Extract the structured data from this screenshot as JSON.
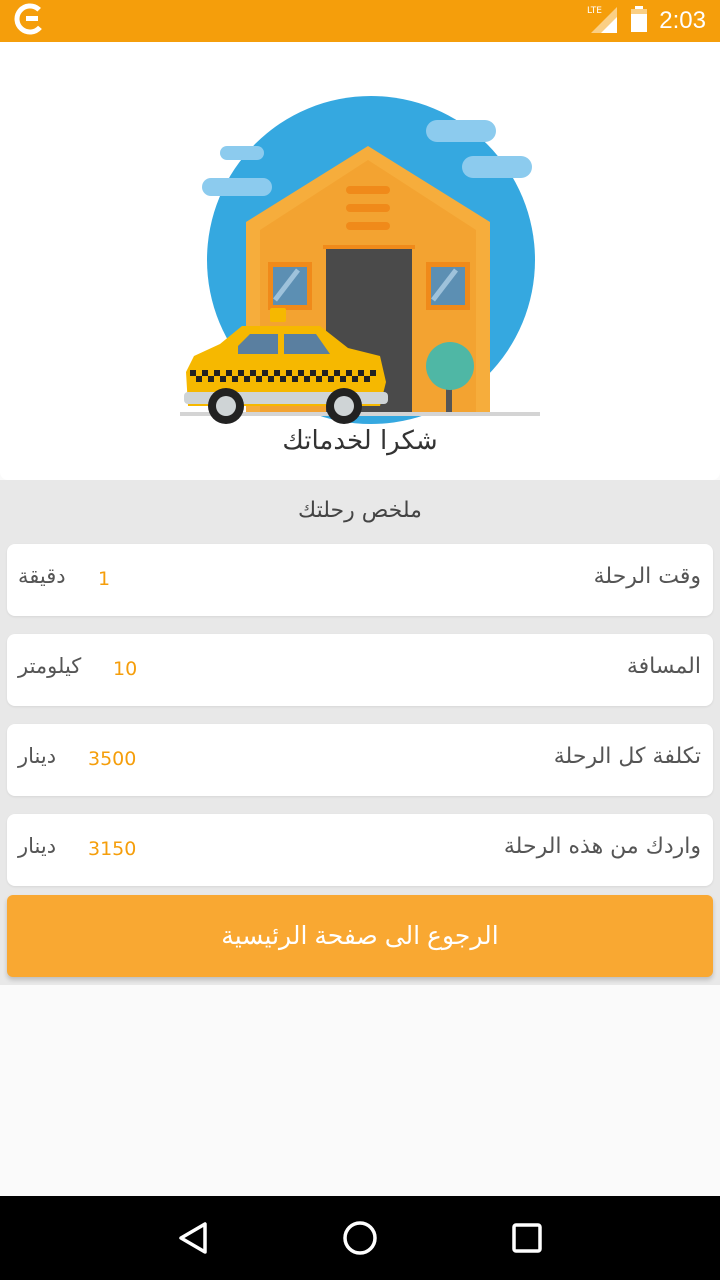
{
  "status_bar": {
    "time": "2:03",
    "network": "LTE",
    "app_icon": "app-logo-icon",
    "signal_icon": "signal-icon",
    "battery_icon": "battery-icon"
  },
  "hero": {
    "thanks_text": "شكرا لخدماتك",
    "illustration": "taxi-house-illustration"
  },
  "summary": {
    "title": "ملخص رحلتك",
    "rows": [
      {
        "label": "وقت الرحلة",
        "value": "1",
        "unit": "دقيقة"
      },
      {
        "label": "المسافة",
        "value": "10",
        "unit": "كيلومتر"
      },
      {
        "label": "تكلفة كل الرحلة",
        "value": "3500",
        "unit": "دينار"
      },
      {
        "label": "واردك من هذه الرحلة",
        "value": "3150",
        "unit": "دينار"
      }
    ]
  },
  "home_button": {
    "label": "الرجوع الى صفحة الرئيسية"
  },
  "nav": {
    "back_icon": "back-triangle-icon",
    "home_icon": "home-circle-icon",
    "recents_icon": "recents-square-icon"
  },
  "colors": {
    "accent": "#f59e0b",
    "button": "#f9a832",
    "sky": "#35a8e0",
    "house": "#f6ad3c"
  }
}
